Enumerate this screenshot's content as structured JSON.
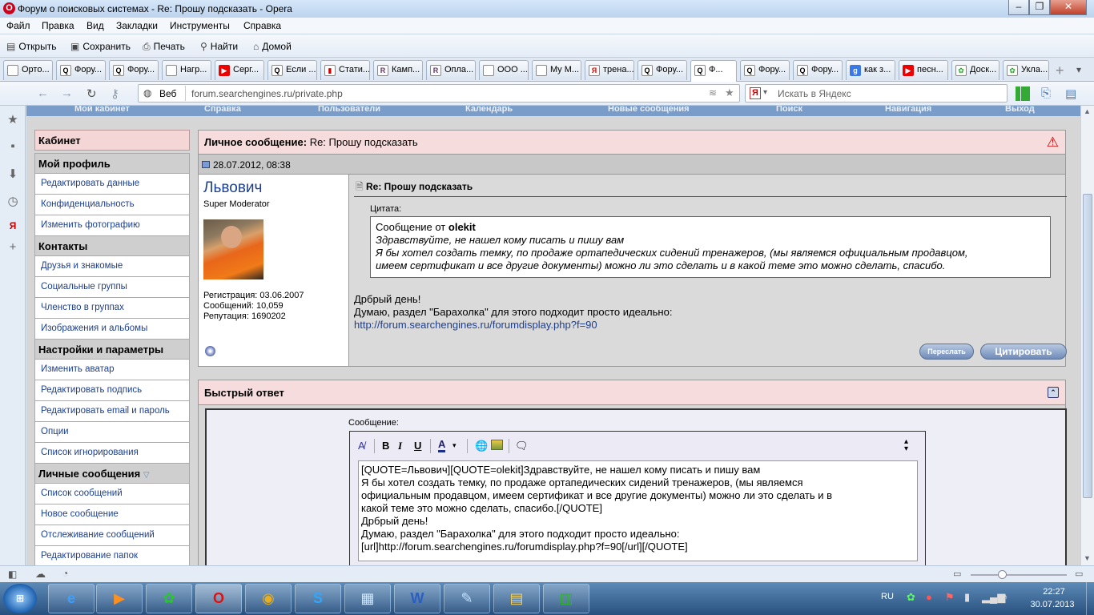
{
  "window": {
    "title": "Форум о поисковых системах - Re: Прошу подсказать - Opera"
  },
  "menu": [
    "Файл",
    "Правка",
    "Вид",
    "Закладки",
    "Инструменты",
    "Справка"
  ],
  "toolbar": {
    "open": "Открыть",
    "save": "Сохранить",
    "print": "Печать",
    "find": "Найти",
    "home": "Домой"
  },
  "tabs": [
    {
      "label": "Орто...",
      "icon": "page-icon"
    },
    {
      "label": "Фору...",
      "icon": "forum-icon"
    },
    {
      "label": "Фору...",
      "icon": "forum-icon"
    },
    {
      "label": "Нагр...",
      "icon": "page-icon"
    },
    {
      "label": "Серг...",
      "icon": "youtube-icon"
    },
    {
      "label": "Если ...",
      "icon": "forum-icon"
    },
    {
      "label": "Стати...",
      "icon": "stats-icon"
    },
    {
      "label": "Камп...",
      "icon": "forum-icon"
    },
    {
      "label": "Опла...",
      "icon": "forum-icon"
    },
    {
      "label": "ООО ...",
      "icon": "page-icon"
    },
    {
      "label": "My M...",
      "icon": "page-icon"
    },
    {
      "label": "трена...",
      "icon": "yandex-icon"
    },
    {
      "label": "Фору...",
      "icon": "forum-icon"
    },
    {
      "label": "Ф...",
      "icon": "forum-icon"
    },
    {
      "label": "Фору...",
      "icon": "forum-icon"
    },
    {
      "label": "Фору...",
      "icon": "forum-icon"
    },
    {
      "label": "как з...",
      "icon": "google-icon"
    },
    {
      "label": "песн...",
      "icon": "youtube-icon"
    },
    {
      "label": "Доск...",
      "icon": "page-icon"
    },
    {
      "label": "Укла...",
      "icon": "page-icon"
    }
  ],
  "address": {
    "mode": "Веб",
    "url": "forum.searchengines.ru/private.php",
    "search_placeholder": "Искать в Яндекс"
  },
  "forumnav": [
    "Мой кабинет",
    "Справка",
    "Пользователи",
    "Календарь",
    "Новые сообщения",
    "Поиск",
    "Навигация",
    "Выход"
  ],
  "sidebar": {
    "cabinet": "Кабинет",
    "profile_head": "Мой профиль",
    "profile_items": [
      "Редактировать данные",
      "Конфиденциальность",
      "Изменить фотографию"
    ],
    "contacts_head": "Контакты",
    "contacts_items": [
      "Друзья и знакомые",
      "Социальные группы",
      "Членство в группах",
      "Изображения и альбомы"
    ],
    "settings_head": "Настройки и параметры",
    "settings_items": [
      "Изменить аватар",
      "Редактировать подпись",
      "Редактировать email и пароль",
      "Опции",
      "Список игнорирования"
    ],
    "pm_head": "Личные сообщения",
    "pm_items": [
      "Список сообщений",
      "Новое сообщение",
      "Отслеживание сообщений",
      "Редактирование папок"
    ]
  },
  "message": {
    "header_label": "Личное сообщение",
    "header_title": "Re: Прошу подсказать",
    "date": "28.07.2012, 08:38",
    "author": "Львович",
    "role": "Super Moderator",
    "registration": "Регистрация: 03.06.2007",
    "posts": "Сообщений: 10,059",
    "reputation": "Репутация: 1690202",
    "subject": "Re: Прошу подсказать",
    "quote_label": "Цитата:",
    "quote_from_prefix": "Сообщение от",
    "quote_from_user": "olekit",
    "quote_lines": [
      "Здравствуйте, не нашел кому писать и пишу вам",
      "Я бы хотел создать темку, по продаже ортапедических сидений тренажеров, (мы являемся официальным продавцом,",
      "имеем сертификат и все другие документы) можно ли это сделать и в какой теме это можно сделать, спасибо."
    ],
    "body_lines": [
      "Дрбрый день!",
      "Думаю, раздел \"Барахолка\" для этого подходит просто идеально:"
    ],
    "link": "http://forum.searchengines.ru/forumdisplay.php?f=90",
    "forward_btn": "Переслать",
    "quote_btn": "Цитировать"
  },
  "quickreply": {
    "title": "Быстрый ответ",
    "message_label": "Сообщение:",
    "text": "[QUOTE=Львович][QUOTE=olekit]Здравствуйте, не нашел кому писать и пишу вам\nЯ бы хотел создать темку, по продаже ортапедических сидений тренажеров, (мы являемся\nофициальным продавцом, имеем сертификат и все другие документы) можно ли это сделать и в\nкакой теме это можно сделать, спасибо.[/QUOTE]\nДрбрый день!\nДумаю, раздел \"Барахолка\" для этого подходит просто идеально:\n[url]http://forum.searchengines.ru/forumdisplay.php?f=90[/url][/QUOTE]"
  },
  "taskbar": {
    "lang": "RU",
    "time": "22:27",
    "date": "30.07.2013"
  }
}
